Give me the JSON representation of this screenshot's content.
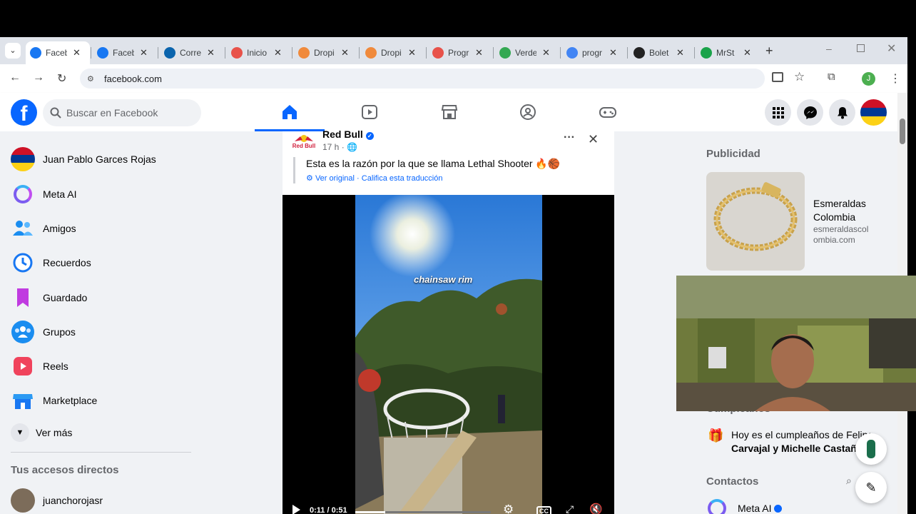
{
  "browser": {
    "tabs": [
      {
        "label": "Faceb",
        "icon": "facebook-icon",
        "color": "#1877f2"
      },
      {
        "label": "Faceb",
        "icon": "facebook-icon",
        "color": "#1877f2"
      },
      {
        "label": "Corre",
        "icon": "outlook-icon",
        "color": "#0a64ad"
      },
      {
        "label": "Inicio",
        "icon": "app-icon",
        "color": "#e8524a"
      },
      {
        "label": "Dropi",
        "icon": "dropi-icon",
        "color": "#f08a3c"
      },
      {
        "label": "Dropi",
        "icon": "dropi-icon",
        "color": "#f08a3c"
      },
      {
        "label": "Progr",
        "icon": "app-icon",
        "color": "#e8524a"
      },
      {
        "label": "Verde",
        "icon": "maps-icon",
        "color": "#34a853"
      },
      {
        "label": "progr",
        "icon": "google-icon",
        "color": "#4285f4"
      },
      {
        "label": "Bolet",
        "icon": "t-icon",
        "color": "#222222"
      },
      {
        "label": "MrSt",
        "icon": "k-icon",
        "color": "#1aa34a"
      }
    ],
    "url": "facebook.com",
    "profile_initial": "J"
  },
  "header": {
    "logo": "f",
    "search_placeholder": "Buscar en Facebook"
  },
  "sidebar": {
    "items": [
      {
        "label": "Juan Pablo Garces Rojas",
        "icon": "avatar-icon"
      },
      {
        "label": "Meta AI",
        "icon": "meta-ai-icon"
      },
      {
        "label": "Amigos",
        "icon": "friends-icon"
      },
      {
        "label": "Recuerdos",
        "icon": "memories-icon"
      },
      {
        "label": "Guardado",
        "icon": "bookmark-icon"
      },
      {
        "label": "Grupos",
        "icon": "groups-icon"
      },
      {
        "label": "Reels",
        "icon": "reels-icon"
      },
      {
        "label": "Marketplace",
        "icon": "marketplace-icon"
      }
    ],
    "see_more": "Ver más",
    "shortcuts_title": "Tus accesos directos",
    "shortcut": "juanchorojasr"
  },
  "post": {
    "author": "Red Bull",
    "time": "17 h ·",
    "text": "Esta es la razón por la que se llama Lethal Shooter 🔥🏀",
    "translate_original": "Ver original",
    "translate_sep": " · ",
    "translate_rate": "Califica esta traducción",
    "brand_logo_text": "Red Bull",
    "video_caption": "chainsaw rim",
    "video_time": "0:11 / 0:51",
    "video_progress": 0.22,
    "cc_label": "CC"
  },
  "rightcol": {
    "ads_title": "Publicidad",
    "ad_name": "Esmeraldas Colombia",
    "ad_url": "esmeraldascolombia.com",
    "birthdays_partial": "Cumpleaños",
    "birthday_text_1": "Hoy es el cumpleaños de Felipe",
    "birthday_text_2": "Carvajal y Michelle Castaño",
    "contacts_title": "Contactos",
    "contact_1": "Meta AI"
  }
}
